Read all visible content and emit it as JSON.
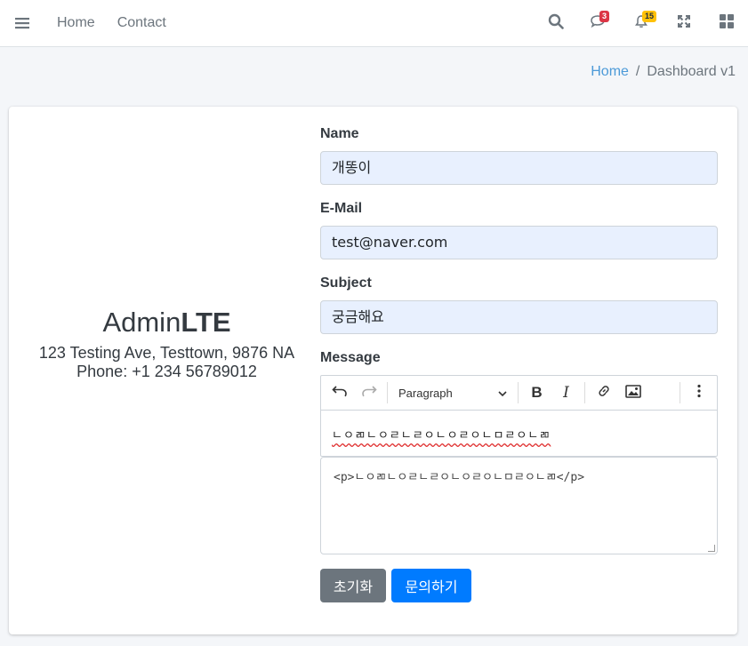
{
  "nav": {
    "links": [
      "Home",
      "Contact"
    ],
    "messages_badge": "3",
    "notifications_badge": "15"
  },
  "breadcrumb": {
    "home": "Home",
    "separator": "/",
    "current": "Dashboard v1"
  },
  "contact": {
    "brand_light": "Admin",
    "brand_bold": "LTE",
    "address": "123 Testing Ave, Testtown, 9876 NA",
    "phone": "Phone: +1 234 56789012"
  },
  "form": {
    "name_label": "Name",
    "name_value": "개똥이",
    "email_label": "E-Mail",
    "email_value": "test@naver.com",
    "subject_label": "Subject",
    "subject_value": "궁금해요",
    "message_label": "Message",
    "paragraph_select": "Paragraph",
    "editor_text": "ㄴㅇㄻㄴㅇㄹㄴㄹㅇㄴㅇㄹㅇㄴㅁㄹㅇㄴㄻ",
    "source_text": "<p>ㄴㅇㄻㄴㅇㄹㄴㄹㅇㄴㅇㄹㅇㄴㅁㄹㅇㄴㄻ</p>",
    "reset_label": "초기화",
    "submit_label": "문의하기"
  },
  "colors": {
    "primary": "#007bff",
    "secondary": "#6c757d",
    "danger": "#dc3545",
    "warning": "#ffc107",
    "autofill_bg": "#e8f0fe"
  },
  "icons": [
    "hamburger-icon",
    "search-icon",
    "comments-icon",
    "bell-icon",
    "expand-icon",
    "grid-icon",
    "undo-icon",
    "redo-icon",
    "bold-icon",
    "italic-icon",
    "link-icon",
    "image-icon",
    "more-icon"
  ]
}
